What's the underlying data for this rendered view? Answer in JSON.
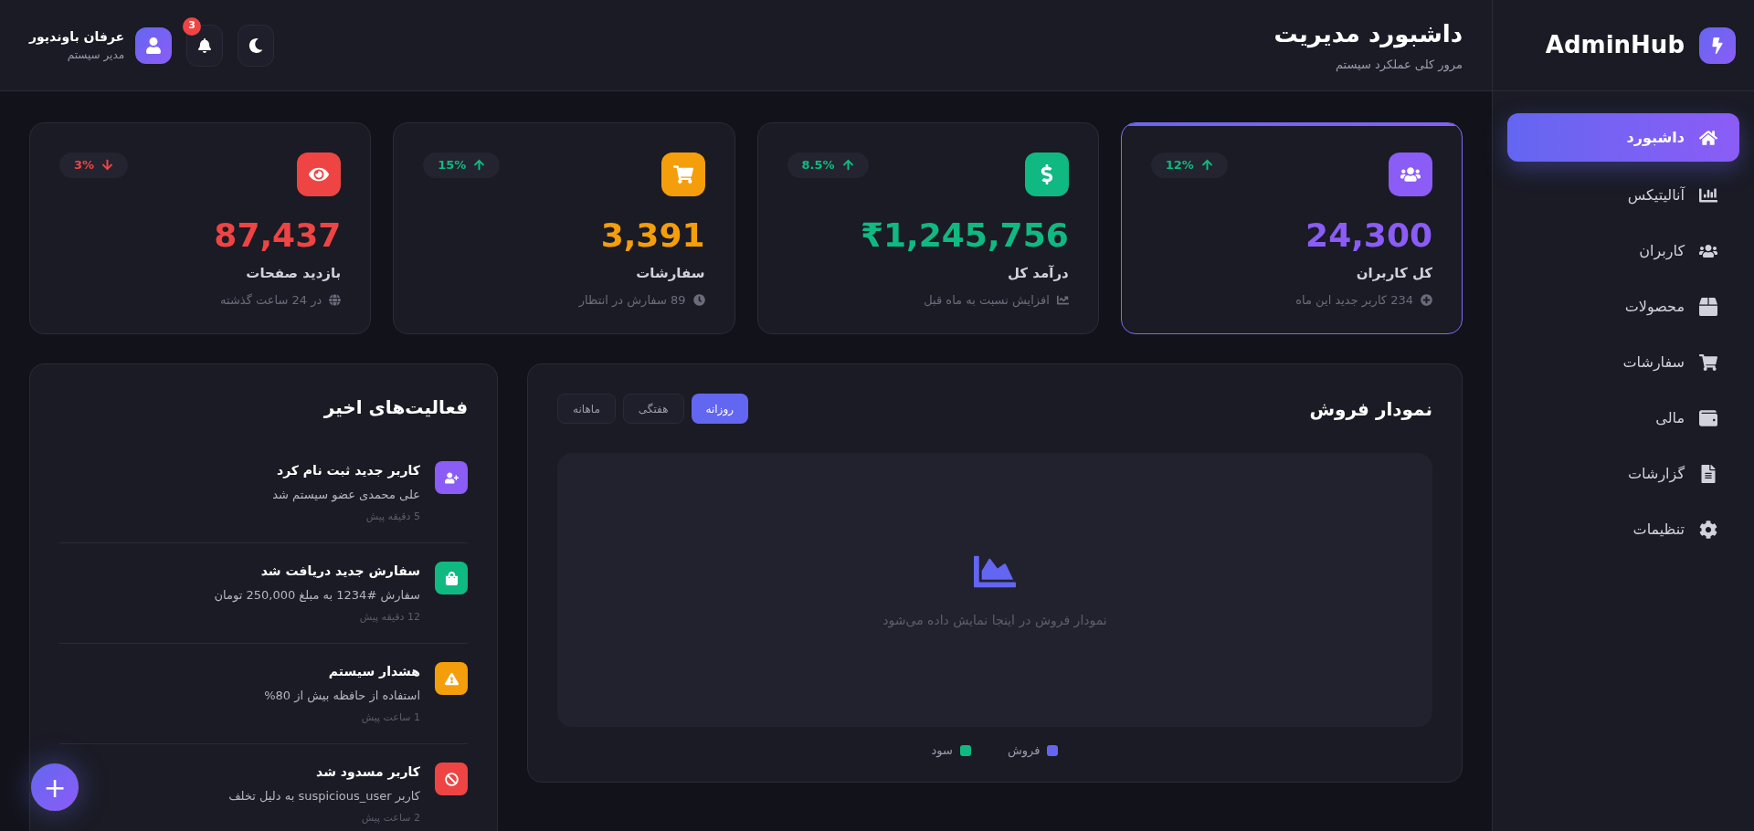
{
  "brand": {
    "name": "AdminHub"
  },
  "sidebar": {
    "items": [
      {
        "label": "داشبورد",
        "selected": true
      },
      {
        "label": "آنالیتیکس",
        "selected": false
      },
      {
        "label": "کاربران",
        "selected": false
      },
      {
        "label": "محصولات",
        "selected": false
      },
      {
        "label": "سفارشات",
        "selected": false
      },
      {
        "label": "مالی",
        "selected": false
      },
      {
        "label": "گزارشات",
        "selected": false
      },
      {
        "label": "تنظیمات",
        "selected": false
      }
    ]
  },
  "header": {
    "title": "داشبورد مدیریت",
    "subtitle": "مرور کلی عملکرد سیستم",
    "user": {
      "name": "عرفان باوندپور",
      "role": "مدیر سیستم"
    },
    "notifications": {
      "count": "3"
    }
  },
  "stats": [
    {
      "kind": "rise",
      "color": "#8b5cf6",
      "value": "24,300",
      "label": "کل کاربران",
      "note": "234 کاربر جدید این ماه",
      "change": "12%",
      "highlighted": true
    },
    {
      "kind": "rise",
      "color": "#10b981",
      "value": "₹1,245,756",
      "label": "درآمد کل",
      "note": "افزایش نسبت به ماه قبل",
      "change": "8.5%",
      "highlighted": false
    },
    {
      "kind": "rise",
      "color": "#f59e0b",
      "value": "3,391",
      "label": "سفارشات",
      "note": "89 سفارش در انتظار",
      "change": "15%",
      "highlighted": false
    },
    {
      "kind": "fall",
      "color": "#ef4444",
      "value": "87,437",
      "label": "بازدید صفحات",
      "note": "در 24 ساعت گذشته",
      "change": "3%",
      "highlighted": false
    }
  ],
  "sales_chart": {
    "title": "نمودار فروش",
    "tabs": [
      {
        "label": "روزانه",
        "selected": true
      },
      {
        "label": "هفتگی",
        "selected": false
      },
      {
        "label": "ماهانه",
        "selected": false
      }
    ],
    "empty_text": "نمودار فروش در اینجا نمایش داده می‌شود",
    "legend": [
      {
        "label": "فروش",
        "color": "#6366f1"
      },
      {
        "label": "سود",
        "color": "#10b981"
      }
    ]
  },
  "activities": {
    "title": "فعالیت‌های اخیر",
    "items": [
      {
        "kind": "user",
        "color": "#8b5cf6",
        "title": "کاربر جدید ثبت نام کرد",
        "text": "علی محمدی عضو سیستم شد",
        "time": "5 دقیقه پیش"
      },
      {
        "kind": "order",
        "color": "#10b981",
        "title": "سفارش جدید دریافت شد",
        "text": "سفارش #1234 به مبلغ 250,000 تومان",
        "time": "12 دقیقه پیش"
      },
      {
        "kind": "warning",
        "color": "#f59e0b",
        "title": "هشدار سیستم",
        "text": "استفاده از حافظه بیش از 80%",
        "time": "1 ساعت پیش"
      },
      {
        "kind": "ban",
        "color": "#ef4444",
        "title": "کاربر مسدود شد",
        "text": "کاربر suspicious_user به دلیل تخلف",
        "time": "2 ساعت پیش"
      }
    ]
  },
  "fab": {
    "label": "+"
  }
}
